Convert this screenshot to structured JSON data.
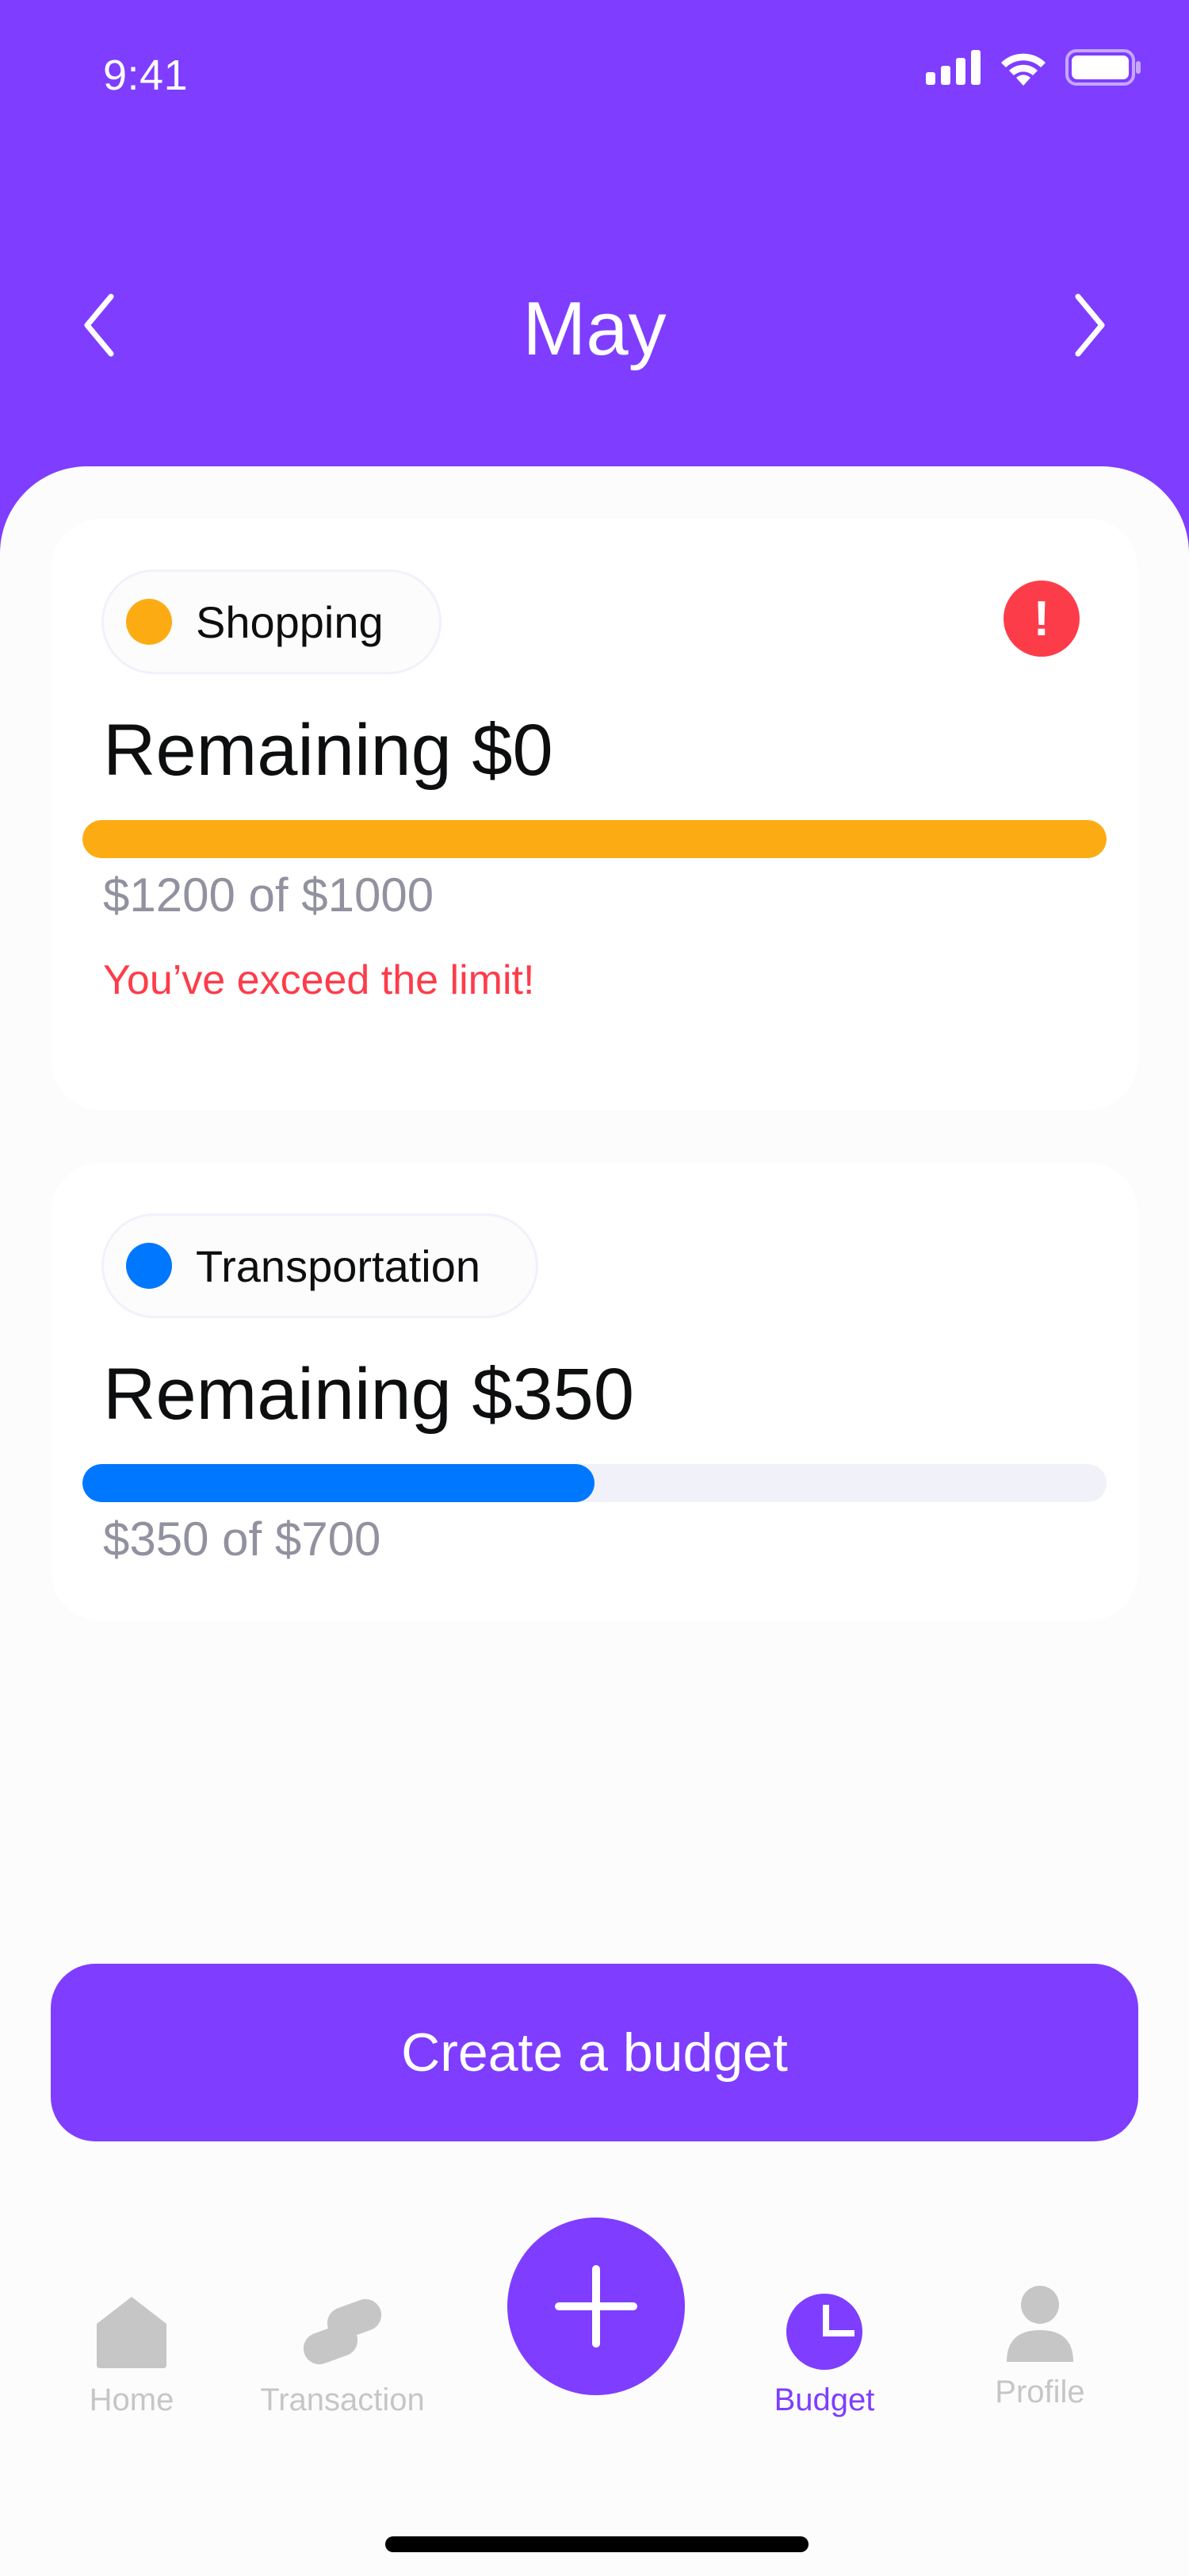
{
  "status_bar": {
    "time": "9:41"
  },
  "header": {
    "month": "May"
  },
  "budgets": [
    {
      "category": "Shopping",
      "category_color": "#FCAC12",
      "remaining_label": "Remaining $0",
      "amount_label": "$1200 of $1000",
      "progress": 1.0,
      "warning": "You’ve exceed the limit!",
      "alert": true
    },
    {
      "category": "Transportation",
      "category_color": "#0077FF",
      "remaining_label": "Remaining $350",
      "amount_label": "$350 of $700",
      "progress": 0.5,
      "alert": false
    }
  ],
  "create_button": {
    "label": "Create a budget"
  },
  "bottom_nav": {
    "items": [
      {
        "label": "Home",
        "icon": "home-icon",
        "active": false
      },
      {
        "label": "Transaction",
        "icon": "transaction-icon",
        "active": false
      },
      {
        "label": "Budget",
        "icon": "pie-chart-icon",
        "active": true
      },
      {
        "label": "Profile",
        "icon": "user-icon",
        "active": false
      }
    ],
    "fab_icon": "plus-icon"
  },
  "colors": {
    "accent": "#7F3DFF",
    "danger": "#FD3C4A",
    "muted": "#91919F",
    "inactive": "#C6C6C6"
  }
}
